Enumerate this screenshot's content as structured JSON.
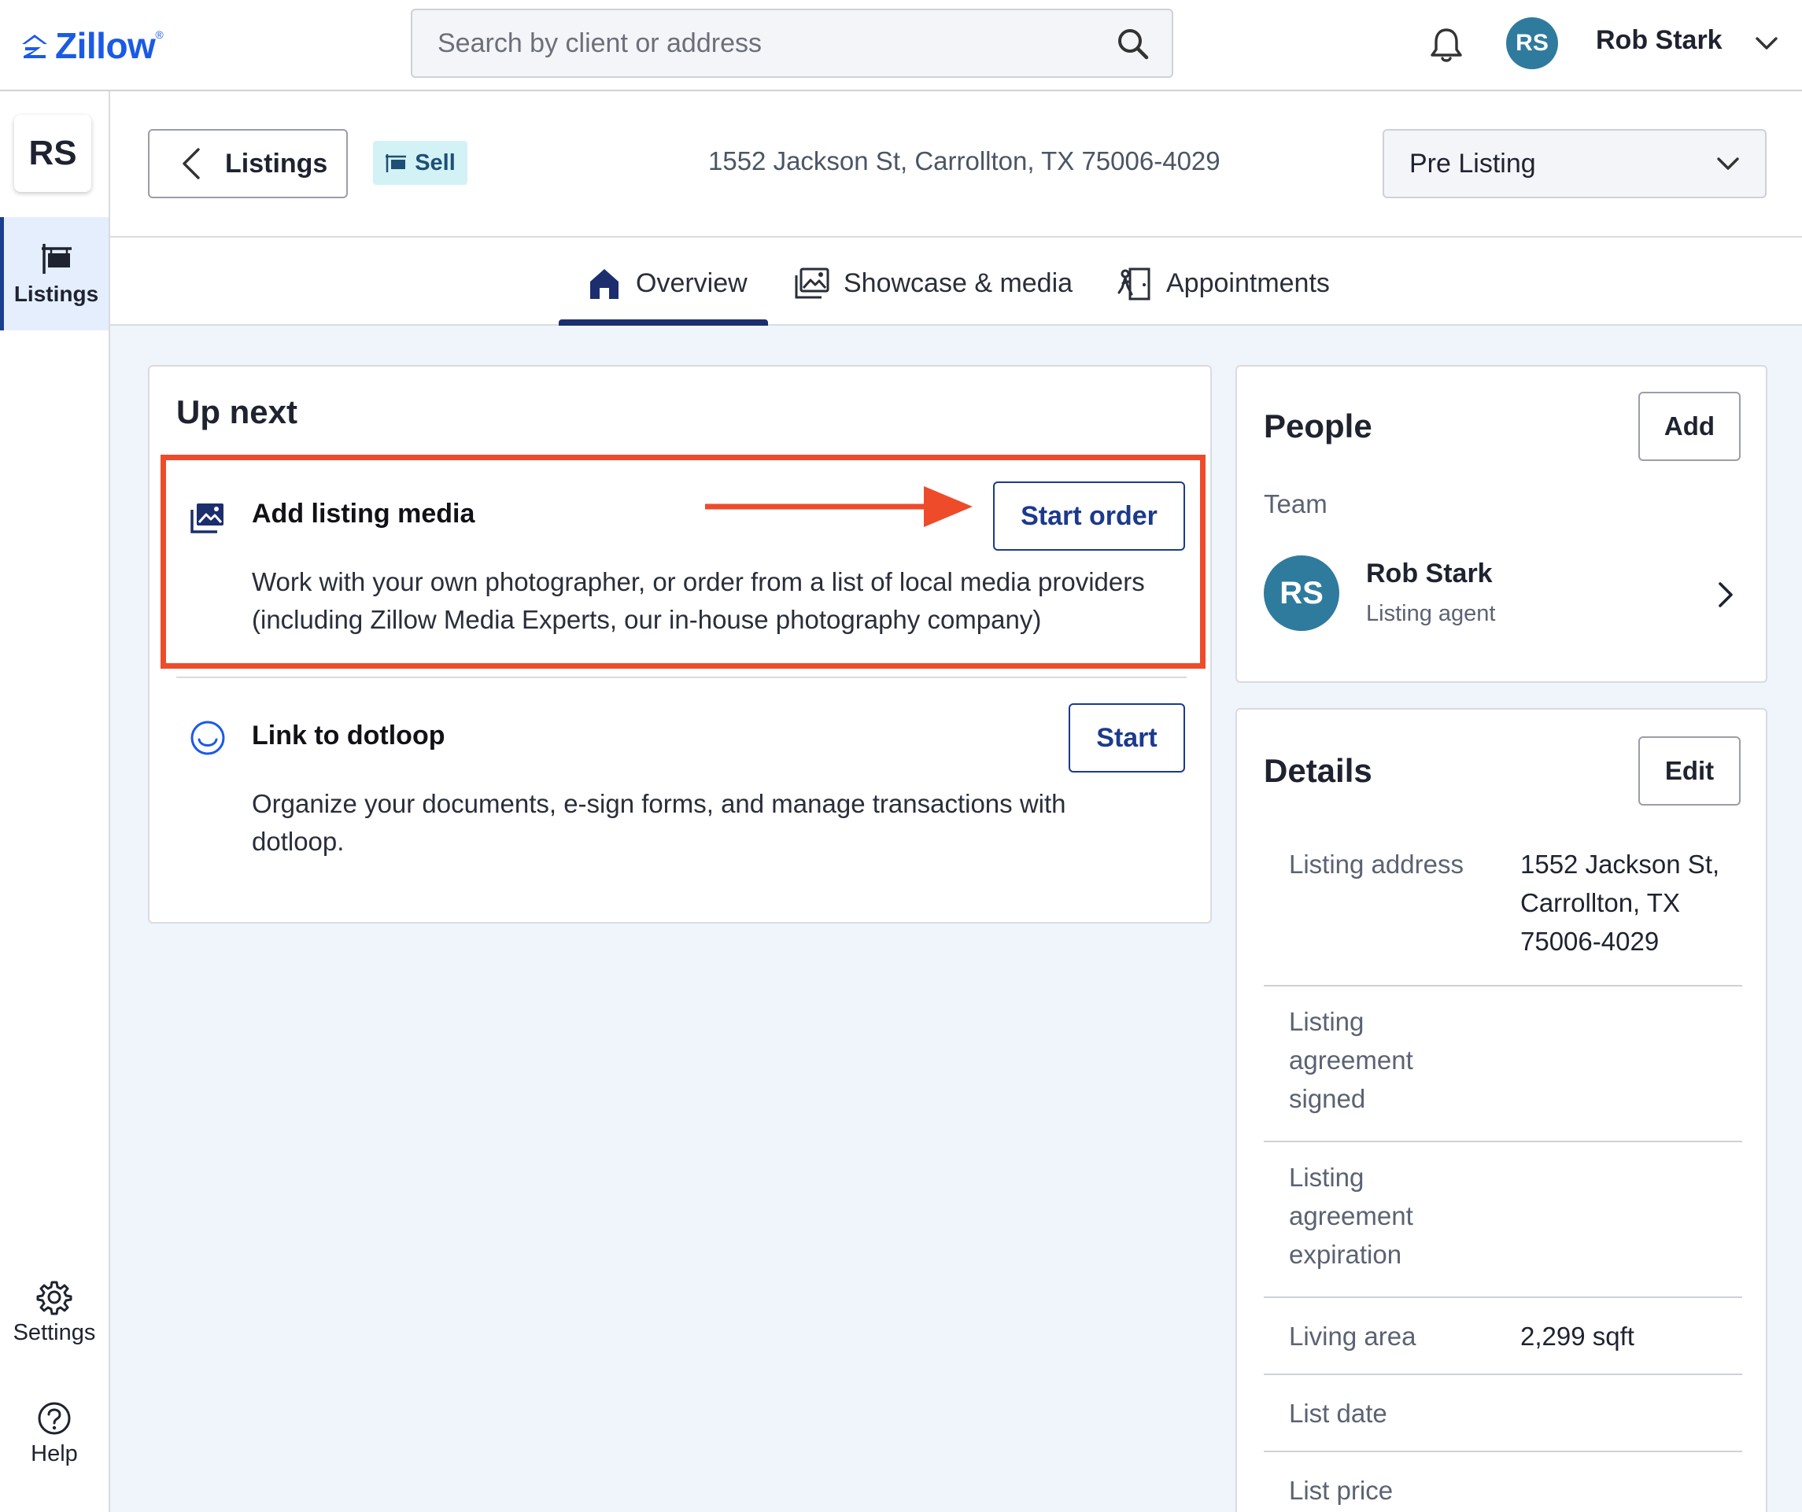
{
  "header": {
    "logo_text": "Zillow",
    "search_placeholder": "Search by client or address",
    "user_initials": "RS",
    "user_name": "Rob Stark"
  },
  "rail": {
    "badge": "RS",
    "items": [
      {
        "label": "Listings",
        "icon": "listing-sign-icon",
        "active": true
      },
      {
        "label": "Settings",
        "icon": "gear-icon"
      },
      {
        "label": "Help",
        "icon": "help-circle-icon"
      }
    ]
  },
  "subheader": {
    "back_label": "Listings",
    "badge_label": "Sell",
    "address": "1552 Jackson St, Carrollton, TX 75006-4029",
    "status": "Pre Listing"
  },
  "tabs": [
    {
      "label": "Overview",
      "icon": "home-icon",
      "active": true
    },
    {
      "label": "Showcase & media",
      "icon": "images-icon"
    },
    {
      "label": "Appointments",
      "icon": "door-icon"
    }
  ],
  "up_next": {
    "title": "Up next",
    "tasks": [
      {
        "title": "Add listing media",
        "description_line1": "Work with your own photographer, or order from a list of local media providers",
        "description_line2": "(including Zillow Media Experts, our in-house photography company)",
        "button": "Start order",
        "icon": "media-icon"
      },
      {
        "title": "Link to dotloop",
        "description_line1": "Organize your documents, e-sign forms, and manage transactions with",
        "description_line2": "dotloop.",
        "button": "Start",
        "icon": "dotloop-icon"
      }
    ]
  },
  "people": {
    "title": "People",
    "add_button": "Add",
    "team_label": "Team",
    "member": {
      "initials": "RS",
      "name": "Rob Stark",
      "role": "Listing agent"
    }
  },
  "details": {
    "title": "Details",
    "edit_button": "Edit",
    "rows": [
      {
        "label_lines": [
          "Listing address"
        ],
        "value_lines": [
          "1552 Jackson St,",
          "Carrollton, TX",
          "75006-4029"
        ]
      },
      {
        "label_lines": [
          "Listing",
          "agreement",
          "signed"
        ],
        "value_lines": []
      },
      {
        "label_lines": [
          "Listing",
          "agreement",
          "expiration"
        ],
        "value_lines": []
      },
      {
        "label_lines": [
          "Living area"
        ],
        "value_lines": [
          "2,299 sqft"
        ]
      },
      {
        "label_lines": [
          "List date"
        ],
        "value_lines": []
      },
      {
        "label_lines": [
          "List price"
        ],
        "value_lines": []
      }
    ]
  },
  "colors": {
    "brand": "#1a5ae6",
    "accent_navy": "#1c3a8c",
    "avatar": "#2f7b9e",
    "highlight": "#ee4b2b"
  }
}
